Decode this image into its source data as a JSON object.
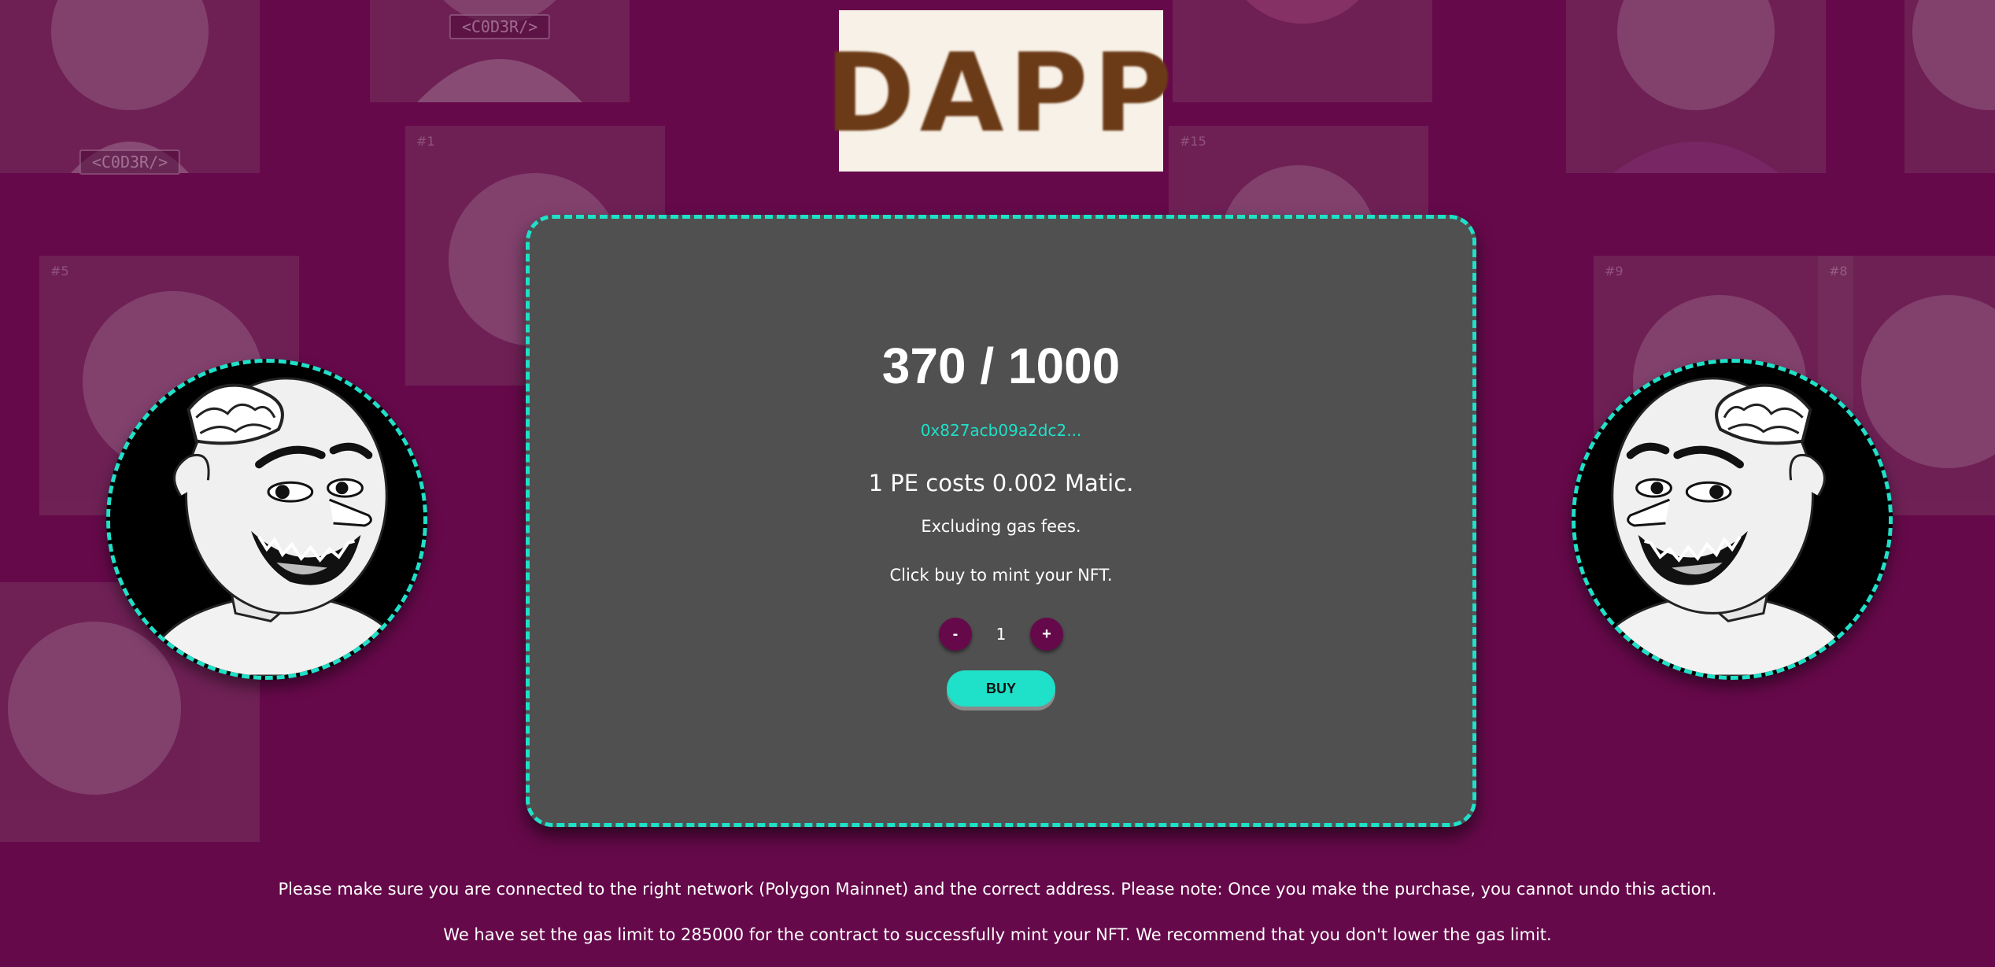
{
  "logo": {
    "text": "DAPP"
  },
  "background": {
    "tags": [
      "<C0D3R/>",
      "<C0D3R/>"
    ],
    "numbers": [
      "#1",
      "#5",
      "#15",
      "#9",
      "#8"
    ]
  },
  "mint": {
    "supply": "370 / 1000",
    "contract_address": "0x827acb09a2dc2...",
    "price_text": "1 PE costs 0.002 Matic.",
    "gas_note": "Excluding gas fees.",
    "instruction": "Click buy to mint your NFT.",
    "quantity": {
      "decrement_label": "-",
      "value": "1",
      "increment_label": "+"
    },
    "buy_label": "BUY"
  },
  "footer": {
    "network_note": "Please make sure you are connected to the right network (Polygon Mainnet) and the correct address. Please note: Once you make the purchase, you cannot undo this action.",
    "gas_limit_note": "We have set the gas limit to 285000 for the contract to successfully mint your NFT. We recommend that you don't lower the gas limit."
  },
  "colors": {
    "background": "#66094a",
    "card": "#505050",
    "accent": "#1fe0c8",
    "logo_bg": "#f8f1e7",
    "logo_text": "#6b3a16"
  },
  "icons": {
    "avatar": "grinning-character-face"
  }
}
